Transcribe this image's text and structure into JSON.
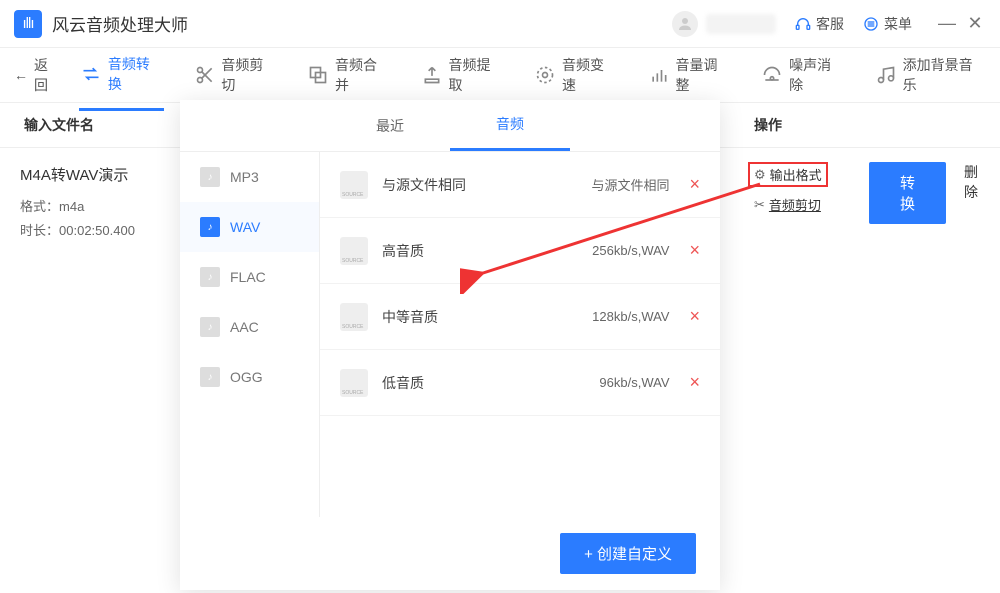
{
  "app": {
    "title": "风云音频处理大师"
  },
  "titlebar": {
    "customer_service": "客服",
    "menu": "菜单"
  },
  "toolbar": {
    "back": "返回",
    "items": [
      {
        "label": "音频转换",
        "active": true
      },
      {
        "label": "音频剪切"
      },
      {
        "label": "音频合并"
      },
      {
        "label": "音频提取"
      },
      {
        "label": "音频变速"
      },
      {
        "label": "音量调整"
      },
      {
        "label": "噪声消除"
      },
      {
        "label": "添加背景音乐"
      }
    ]
  },
  "headers": {
    "input": "输入文件名",
    "ops": "操作"
  },
  "file": {
    "name": "M4A转WAV演示",
    "format_label": "格式：",
    "format": "m4a",
    "duration_label": "时长：",
    "duration": "00:02:50.400"
  },
  "ops": {
    "output_format": "输出格式",
    "audio_cut": "音频剪切",
    "convert": "转换",
    "delete": "删除"
  },
  "panel": {
    "tabs": {
      "recent": "最近",
      "audio": "音频"
    },
    "formats": [
      "MP3",
      "WAV",
      "FLAC",
      "AAC",
      "OGG"
    ],
    "active_format": "WAV",
    "quality": [
      {
        "name": "与源文件相同",
        "spec": "与源文件相同"
      },
      {
        "name": "高音质",
        "spec": "256kb/s,WAV"
      },
      {
        "name": "中等音质",
        "spec": "128kb/s,WAV"
      },
      {
        "name": "低音质",
        "spec": "96kb/s,WAV"
      }
    ],
    "create_custom": "+  创建自定义"
  }
}
